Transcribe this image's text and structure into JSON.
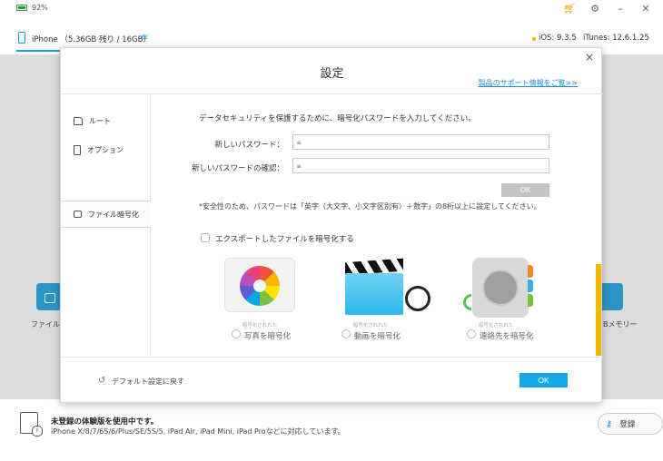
{
  "topbar": {
    "battery_pct": "92%",
    "icons": [
      "cart-icon",
      "gear-icon",
      "minimize-icon",
      "close-icon"
    ]
  },
  "device": {
    "name": "iPhone （5.36GB 残り / 16GB）",
    "ios": "iOS: 9.3.5",
    "itunes": "iTunes: 12.6.1.25"
  },
  "background": {
    "left_label": "ファイル暗",
    "right_label": "Bメモリー"
  },
  "dialog": {
    "title": "設定",
    "close": "×",
    "support_link": "製品のサポート情報をご覧>>",
    "sidebar": [
      {
        "label": "ルート"
      },
      {
        "label": "オプション"
      },
      {
        "label": "ファイル暗号化"
      }
    ],
    "intro": "データセキュリティを保護するために、暗号化パスワードを入力してください。",
    "new_pw_label": "新しいパスワード：",
    "confirm_pw_label": "新しいパスワードの確認：",
    "new_pw_value": "",
    "confirm_pw_value": "",
    "ok_small": "OK",
    "note": "*安全性のため、パスワードは「英字（大文字、小文字区別有）＋数字」の8桁以上に設定してください。",
    "export_label": "エクスポートしたファイルを暗号化する",
    "media": [
      {
        "caption": "暗号化されれた",
        "label": "写真を暗号化"
      },
      {
        "caption": "暗号化されれた",
        "label": "動画を暗号化"
      },
      {
        "caption": "暗号化されれた",
        "label": "連絡先を暗号化"
      }
    ],
    "reset_label": "デフォルト設定に戻す",
    "ok_main": "OK"
  },
  "bottom": {
    "title": "未登録の体験版を使用中です。",
    "subtitle": "iPhone X/8/7/6S/6/Plus/SE/5S/5, iPad Air, iPad Mini, iPad Proなどに対応しています。",
    "register": "登録"
  },
  "colors": {
    "accent": "#1a9bd7",
    "ok_button": "#14a8e8",
    "disabled_button": "#c4c4c4",
    "highlight": "#f5b800"
  }
}
